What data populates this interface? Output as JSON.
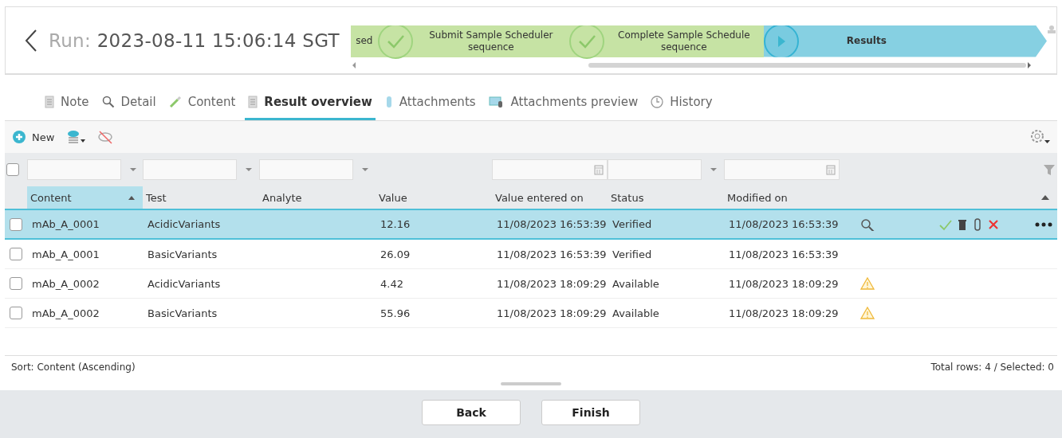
{
  "header": {
    "title_prefix": "Run:",
    "title": "2023-08-11 15:06:14 SGT"
  },
  "steps": [
    {
      "label": "sed",
      "kind": "done",
      "circle": false
    },
    {
      "label": "Submit Sample Scheduler sequence",
      "kind": "done",
      "circle": true
    },
    {
      "label": "Complete Sample Schedule sequence",
      "kind": "done",
      "circle": true
    },
    {
      "label": "Results",
      "kind": "current",
      "circle": true
    }
  ],
  "tabs": [
    {
      "label": "Note",
      "selected": false
    },
    {
      "label": "Detail",
      "selected": false
    },
    {
      "label": "Content",
      "selected": false
    },
    {
      "label": "Result overview",
      "selected": true
    },
    {
      "label": "Attachments",
      "selected": false
    },
    {
      "label": "Attachments preview",
      "selected": false
    },
    {
      "label": "History",
      "selected": false
    }
  ],
  "select_all": {
    "checked": false
  },
  "toolbar": {
    "new_label": "New"
  },
  "filters": [
    {
      "kind": "select"
    },
    {
      "kind": "select"
    },
    {
      "kind": "select"
    },
    {
      "kind": "none"
    },
    {
      "kind": "date"
    },
    {
      "kind": "select"
    },
    {
      "kind": "date"
    }
  ],
  "columns": [
    {
      "label": "Content",
      "sorted": true
    },
    {
      "label": "Test",
      "sorted": false
    },
    {
      "label": "Analyte",
      "sorted": false
    },
    {
      "label": "Value",
      "sorted": false
    },
    {
      "label": "Value entered on",
      "sorted": false
    },
    {
      "label": "Status",
      "sorted": false
    },
    {
      "label": "Modified on",
      "sorted": false
    }
  ],
  "rows": [
    {
      "selected": true,
      "checked": false,
      "warning": false,
      "cells": [
        "mAb_A_0001",
        "AcidicVariants",
        "",
        "12.16",
        "11/08/2023 16:53:39",
        "Verified",
        "11/08/2023 16:53:39"
      ]
    },
    {
      "selected": false,
      "checked": false,
      "warning": false,
      "cells": [
        "mAb_A_0001",
        "BasicVariants",
        "",
        "26.09",
        "11/08/2023 16:53:39",
        "Verified",
        "11/08/2023 16:53:39"
      ]
    },
    {
      "selected": false,
      "checked": false,
      "warning": true,
      "cells": [
        "mAb_A_0002",
        "AcidicVariants",
        "",
        "4.42",
        "11/08/2023 18:09:29",
        "Available",
        "11/08/2023 18:09:29"
      ]
    },
    {
      "selected": false,
      "checked": false,
      "warning": true,
      "cells": [
        "mAb_A_0002",
        "BasicVariants",
        "",
        "55.96",
        "11/08/2023 18:09:29",
        "Available",
        "11/08/2023 18:09:29"
      ]
    }
  ],
  "footer": {
    "sort": "Sort: Content (Ascending)",
    "totals": "Total rows: 4 / Selected: 0"
  },
  "buttons": [
    "Back",
    "Finish"
  ]
}
